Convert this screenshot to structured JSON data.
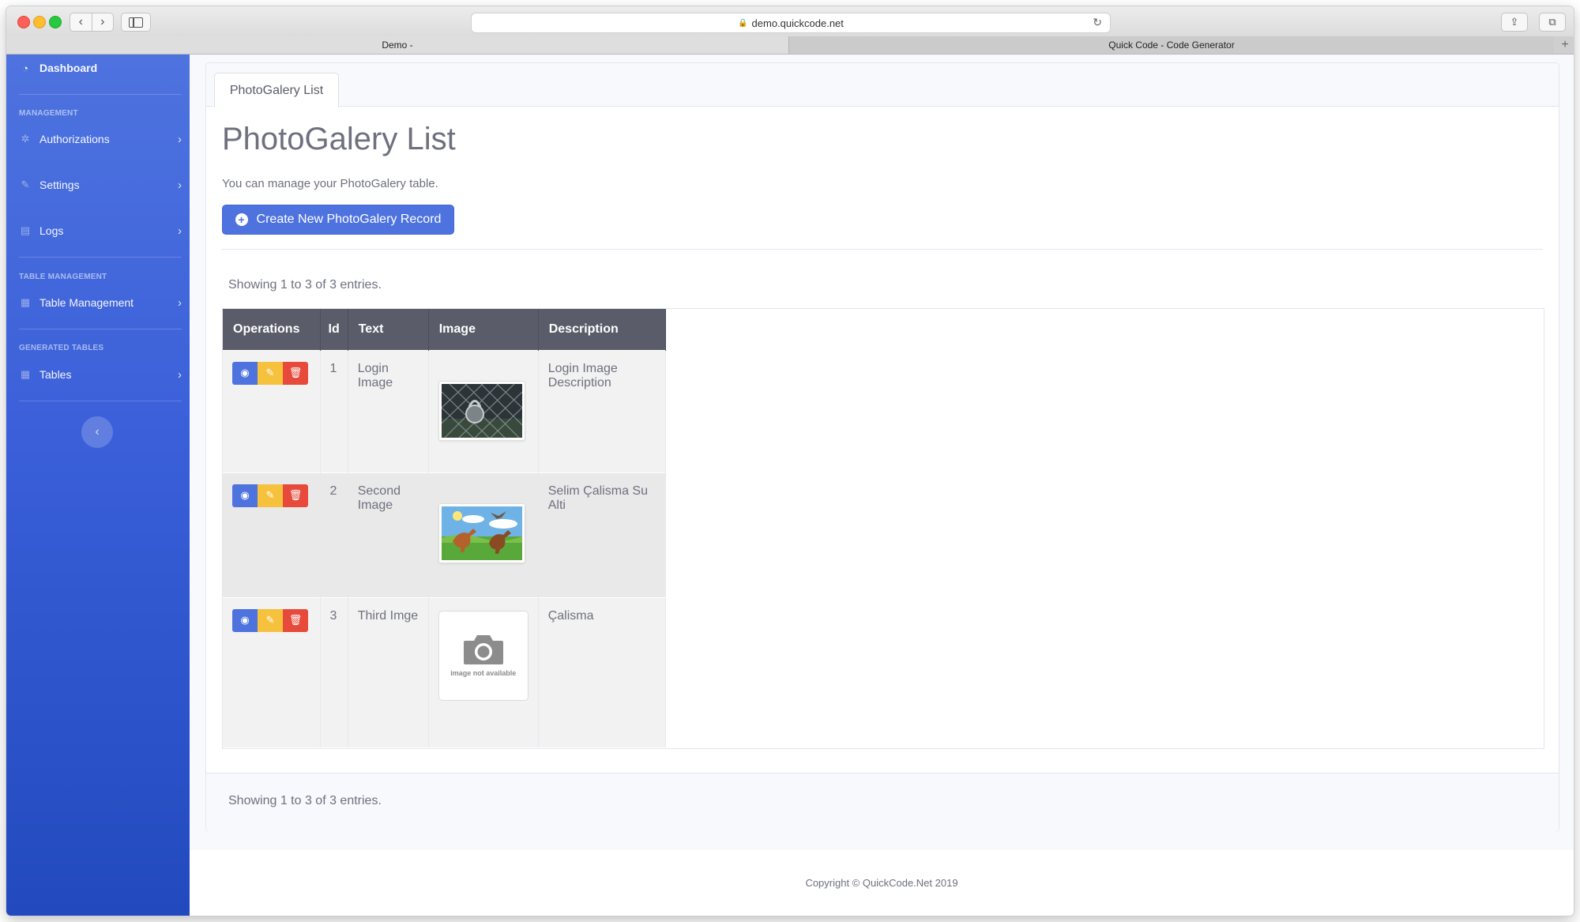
{
  "browser": {
    "url": "demo.quickcode.net",
    "tabs": [
      "Demo -",
      "Quick Code - Code Generator"
    ]
  },
  "sidebar": {
    "dashboard": "Dashboard",
    "sections": {
      "management": "MANAGEMENT",
      "table_management": "TABLE MANAGEMENT",
      "generated_tables": "GENERATED TABLES"
    },
    "items": {
      "authorizations": "Authorizations",
      "settings": "Settings",
      "logs": "Logs",
      "table_management": "Table Management",
      "tables": "Tables"
    }
  },
  "page": {
    "tab": "PhotoGalery List",
    "title": "PhotoGalery List",
    "subtitle": "You can manage your PhotoGalery table.",
    "create_button": "Create New PhotoGalery Record",
    "showing_top": "Showing 1 to 3 of 3 entries.",
    "showing_bottom": "Showing 1 to 3 of 3 entries."
  },
  "table": {
    "headers": [
      "Operations",
      "Id",
      "Text",
      "Image",
      "Description"
    ],
    "rows": [
      {
        "id": "1",
        "text": "Login Image",
        "description": "Login Image Description",
        "image": "padlock-photo"
      },
      {
        "id": "2",
        "text": "Second Image",
        "description": "Selim Çalisma Su Alti",
        "image": "dinosaur-photo"
      },
      {
        "id": "3",
        "text": "Third Imge",
        "description": "Çalisma",
        "image": "image-not-available"
      }
    ],
    "no_image_caption": "image not available"
  },
  "footer": {
    "copyright": "Copyright © QuickCode.Net 2019"
  },
  "colors": {
    "primary": "#4e73df",
    "warning": "#f6c23e",
    "danger": "#e74a3b",
    "table_header": "#5a5c69",
    "text": "#6e707e"
  }
}
